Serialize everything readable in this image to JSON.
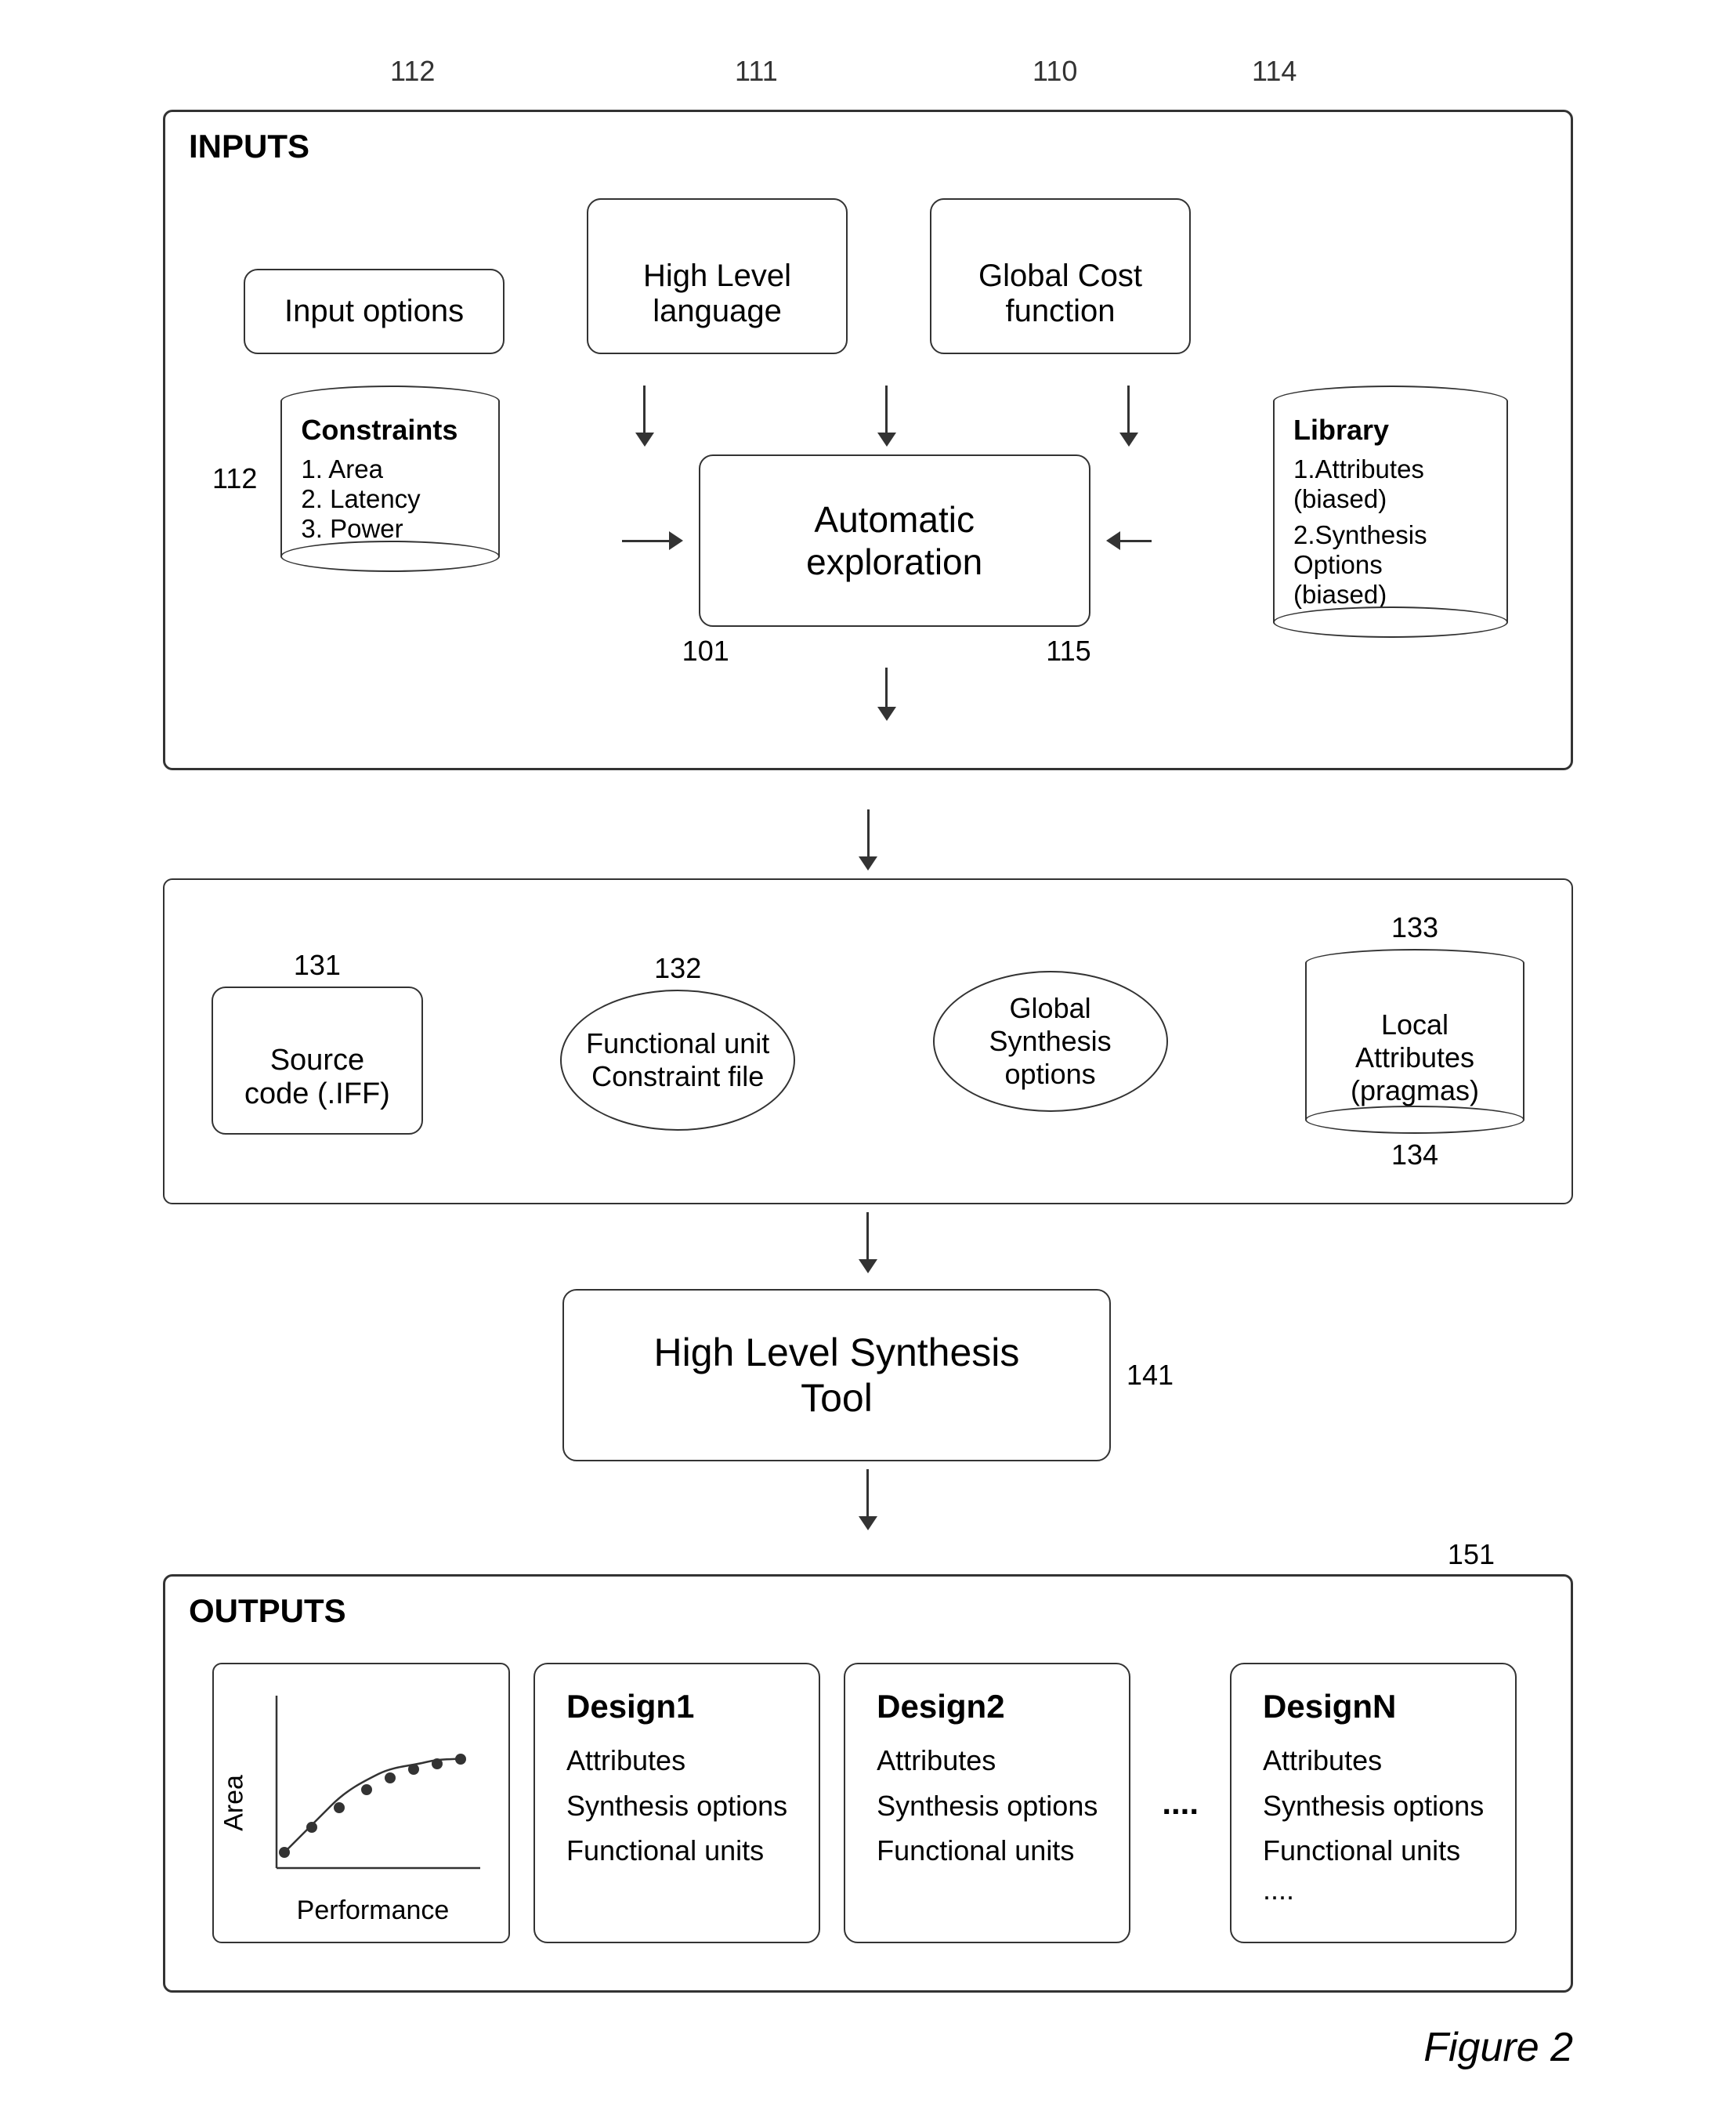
{
  "inputs_label": "INPUTS",
  "outputs_label": "OUTPUTS",
  "ref_110": "110",
  "ref_111": "111",
  "ref_112_top": "112",
  "ref_112_side": "112",
  "ref_114": "114",
  "ref_101": "101",
  "ref_115": "115",
  "ref_131": "131",
  "ref_132": "132",
  "ref_133": "133",
  "ref_134": "134",
  "ref_141": "141",
  "ref_151": "151",
  "input_options_label": "Input options",
  "high_level_language_label": "High Level\nlanguage",
  "global_cost_function_label": "Global Cost\nfunction",
  "automatic_exploration_label": "Automatic\nexploration",
  "constraints_title": "Constraints",
  "constraints_items": [
    "1. Area",
    "2. Latency",
    "3. Power"
  ],
  "library_title": "Library",
  "library_items": [
    "1.Attributes\n(biased)",
    "2.Synthesis\nOptions\n(biased)"
  ],
  "source_code_label": "Source\ncode (.IFF)",
  "functional_unit_label": "Functional unit\nConstraint file",
  "global_synthesis_label": "Global\nSynthesis\noptions",
  "local_attributes_label": "Local\nAttributes\n(pragmas)",
  "hls_tool_label": "High Level Synthesis\nTool",
  "performance_label": "Performance",
  "area_label": "Area",
  "design1_title": "Design1",
  "design1_items": [
    "Attributes",
    "Synthesis options",
    "Functional units"
  ],
  "design2_title": "Design2",
  "design2_items": [
    "Attributes",
    "Synthesis options",
    "Functional units"
  ],
  "designN_title": "DesignN",
  "designN_items": [
    "Attributes",
    "Synthesis options",
    "Functional units"
  ],
  "ellipsis": "....",
  "figure_label": "Figure 2"
}
